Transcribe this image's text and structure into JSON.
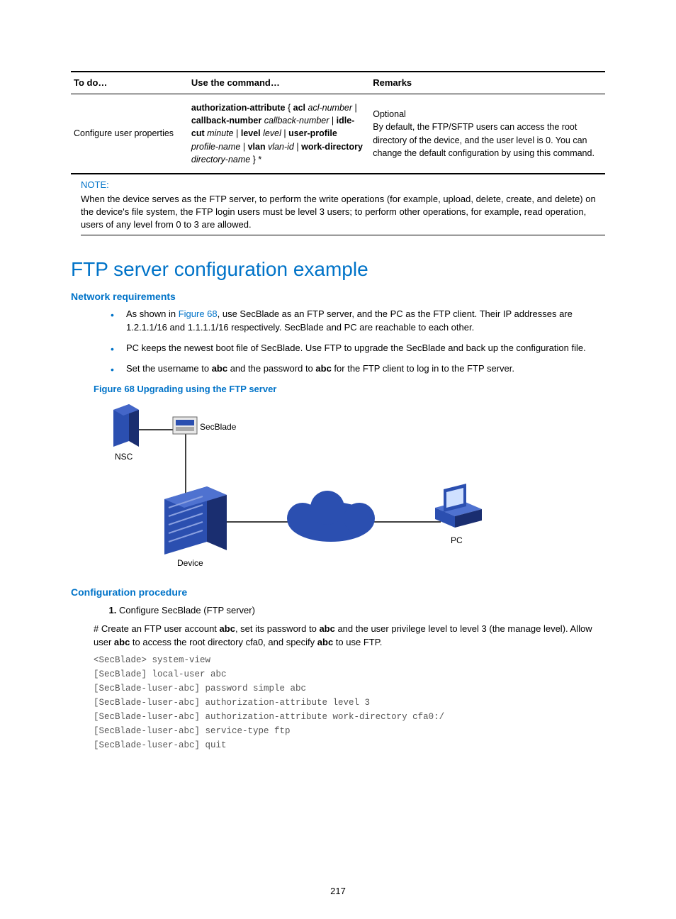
{
  "table": {
    "headers": [
      "To do…",
      "Use the command…",
      "Remarks"
    ],
    "row": {
      "todo": "Configure user properties",
      "remarks": "Optional\nBy default, the FTP/SFTP users can access the root directory of the device, and the user level is 0. You can change the default configuration by using this command."
    }
  },
  "note": {
    "label": "NOTE:",
    "text": "When the device serves as the FTP server, to perform the write operations (for example, upload, delete, create, and delete) on the device's file system, the FTP login users must be level 3 users; to perform other operations, for example, read operation, users of any level from 0 to 3 are allowed."
  },
  "section_title": "FTP server configuration example",
  "network_req_heading": "Network requirements",
  "req_item1_pre": "As shown in ",
  "req_item1_link": "Figure 68",
  "req_item1_post": ", use SecBlade as an FTP server, and the PC as the FTP client. Their IP addresses are 1.2.1.1/16 and 1.1.1.1/16 respectively. SecBlade and PC are reachable to each other.",
  "req_item2": "PC keeps the newest boot file of SecBlade. Use FTP to upgrade the SecBlade and back up the configuration file.",
  "req_item3_pre": "Set the username to ",
  "req_item3_b1": "abc",
  "req_item3_mid": " and the password to ",
  "req_item3_b2": "abc",
  "req_item3_post": " for the FTP client to log in to the FTP server.",
  "figure_caption": "Figure 68 Upgrading using the FTP server",
  "diagram_labels": {
    "secblade": "SecBlade",
    "nsc": "NSC",
    "device": "Device",
    "pc": "PC"
  },
  "config_proc_heading": "Configuration procedure",
  "proc_step1": "Configure SecBlade (FTP server)",
  "proc_para_pre": "# Create an FTP user account ",
  "proc_para_b1": "abc",
  "proc_para_m1": ", set its password to ",
  "proc_para_b2": "abc",
  "proc_para_m2": " and the user privilege level to level 3 (the manage level). Allow user ",
  "proc_para_b3": "abc",
  "proc_para_m3": " to access the root directory cfa0, and specify ",
  "proc_para_b4": "abc",
  "proc_para_m4": " to use FTP.",
  "cli": "<SecBlade> system-view\n[SecBlade] local-user abc\n[SecBlade-luser-abc] password simple abc\n[SecBlade-luser-abc] authorization-attribute level 3\n[SecBlade-luser-abc] authorization-attribute work-directory cfa0:/\n[SecBlade-luser-abc] service-type ftp\n[SecBlade-luser-abc] quit",
  "page_number": "217"
}
